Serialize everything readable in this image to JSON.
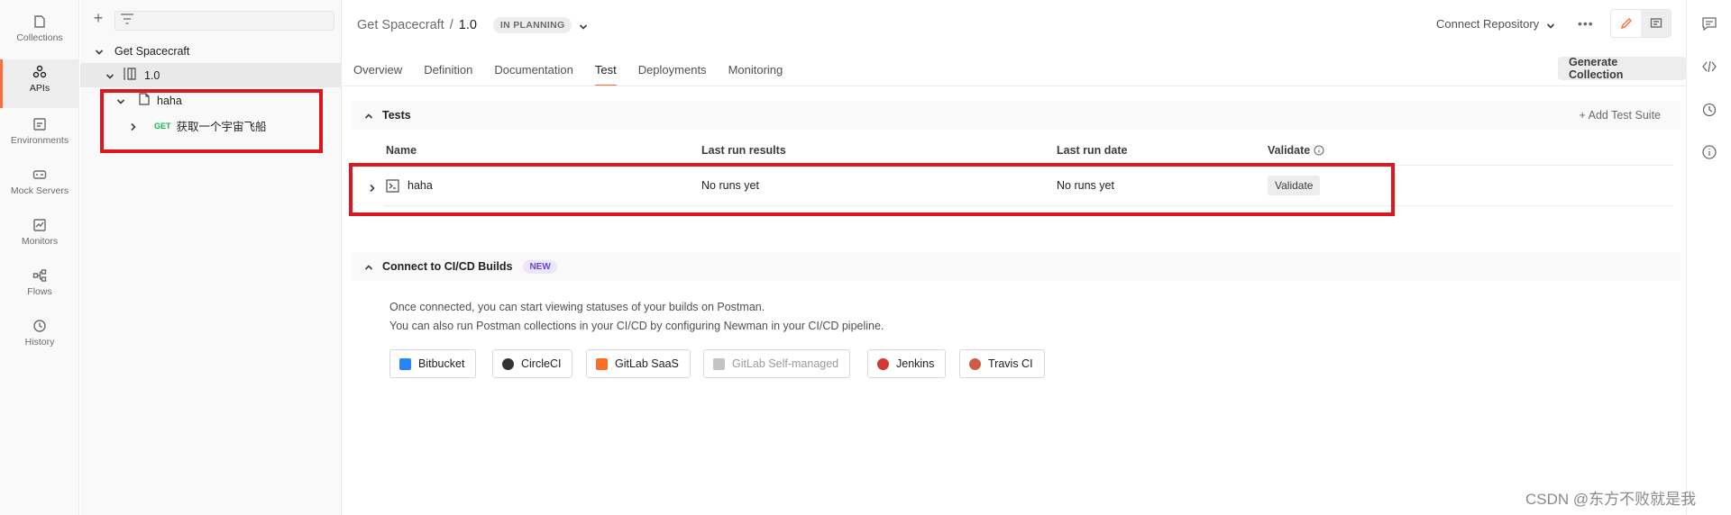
{
  "rail": [
    {
      "key": "collections",
      "label": "Collections",
      "icon": "collections-icon"
    },
    {
      "key": "apis",
      "label": "APIs",
      "icon": "apis-icon",
      "active": true
    },
    {
      "key": "environments",
      "label": "Environments",
      "icon": "environments-icon"
    },
    {
      "key": "mock_servers",
      "label": "Mock Servers",
      "icon": "mock-servers-icon"
    },
    {
      "key": "monitors",
      "label": "Monitors",
      "icon": "monitors-icon"
    },
    {
      "key": "flows",
      "label": "Flows",
      "icon": "flows-icon"
    },
    {
      "key": "history",
      "label": "History",
      "icon": "history-icon"
    }
  ],
  "sidebar": {
    "search_value": "",
    "tree": {
      "api_name": "Get Spacecraft",
      "version": "1.0",
      "collection": "haha",
      "request_method": "GET",
      "request_name": "获取一个宇宙飞船"
    }
  },
  "header": {
    "crumb_parent": "Get Spacecraft",
    "crumb_sep": "/",
    "crumb_current": "1.0",
    "status": "IN PLANNING",
    "connect_repo": "Connect Repository",
    "more": "•••"
  },
  "tabs": [
    "Overview",
    "Definition",
    "Documentation",
    "Test",
    "Deployments",
    "Monitoring"
  ],
  "active_tab": "Test",
  "generate_collection": "Generate Collection",
  "tests": {
    "title": "Tests",
    "add_suite": "+  Add Test Suite",
    "columns": {
      "name": "Name",
      "last_results": "Last run results",
      "last_date": "Last run date",
      "validate": "Validate"
    },
    "rows": [
      {
        "name": "haha",
        "last_results": "No runs yet",
        "last_date": "No runs yet",
        "action": "Validate"
      }
    ]
  },
  "cicd": {
    "title": "Connect to CI/CD Builds",
    "badge": "NEW",
    "line1": "Once connected, you can start viewing statuses of your builds on Postman.",
    "line2": "You can also run Postman collections in your CI/CD by configuring Newman in your CI/CD pipeline.",
    "providers": [
      {
        "label": "Bitbucket",
        "color": "#2684ff"
      },
      {
        "label": "CircleCI",
        "color": "#343434"
      },
      {
        "label": "GitLab SaaS",
        "color": "#fc6d26"
      },
      {
        "label": "GitLab Self-managed",
        "color": "#c4c4c4",
        "disabled": true
      },
      {
        "label": "Jenkins",
        "color": "#d33833"
      },
      {
        "label": "Travis CI",
        "color": "#cd5c45"
      }
    ]
  },
  "watermark": "CSDN @东方不败就是我",
  "colors": {
    "accent": "#ff6c37",
    "annotation": "#e0161e"
  }
}
